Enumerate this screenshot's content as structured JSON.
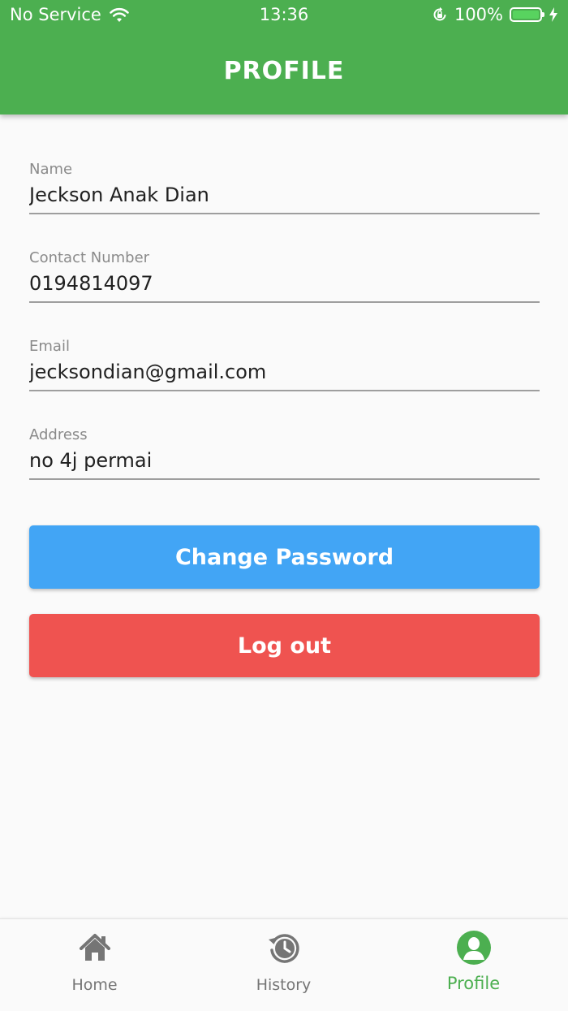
{
  "status_bar": {
    "carrier": "No Service",
    "time": "13:36",
    "battery_pct": "100%",
    "battery_level": 1.0,
    "icons": [
      "wifi-icon",
      "orientation-lock-icon",
      "battery-icon",
      "charging-icon"
    ]
  },
  "header": {
    "title": "PROFILE"
  },
  "form": {
    "name": {
      "label": "Name",
      "value": "Jeckson Anak Dian"
    },
    "contact": {
      "label": "Contact Number",
      "value": "0194814097"
    },
    "email": {
      "label": "Email",
      "value": "jecksondian@gmail.com"
    },
    "address": {
      "label": "Address",
      "value": "no 4j permai"
    }
  },
  "actions": {
    "change_password": "Change Password",
    "logout": "Log out"
  },
  "bottom_nav": {
    "items": [
      {
        "label": "Home",
        "icon": "home-icon",
        "active": false
      },
      {
        "label": "History",
        "icon": "history-icon",
        "active": false
      },
      {
        "label": "Profile",
        "icon": "profile-icon",
        "active": true
      }
    ]
  },
  "colors": {
    "primary": "#4caf50",
    "change_password_button": "#42a5f5",
    "logout_button": "#ef5350",
    "inactive_nav": "#757575"
  }
}
